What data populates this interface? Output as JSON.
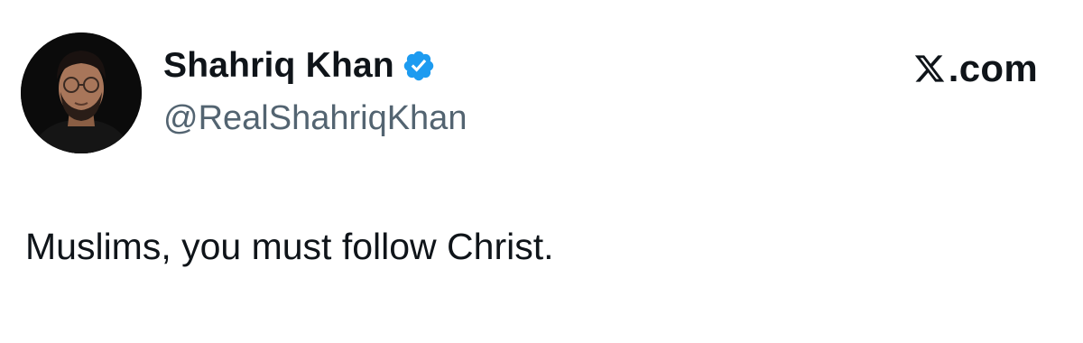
{
  "author": {
    "display_name": "Shahriq Khan",
    "handle": "@RealShahriqKhan",
    "verified": true,
    "avatar_icon": "profile-photo",
    "verified_icon": "verified-badge-icon"
  },
  "branding": {
    "site_text": ".com",
    "logo_icon": "x-logo-icon"
  },
  "tweet": {
    "text": "Muslims, you must follow Christ."
  },
  "colors": {
    "text_primary": "#0f1419",
    "text_secondary": "#536471",
    "verified_blue": "#1d9bf0",
    "background": "#ffffff"
  }
}
